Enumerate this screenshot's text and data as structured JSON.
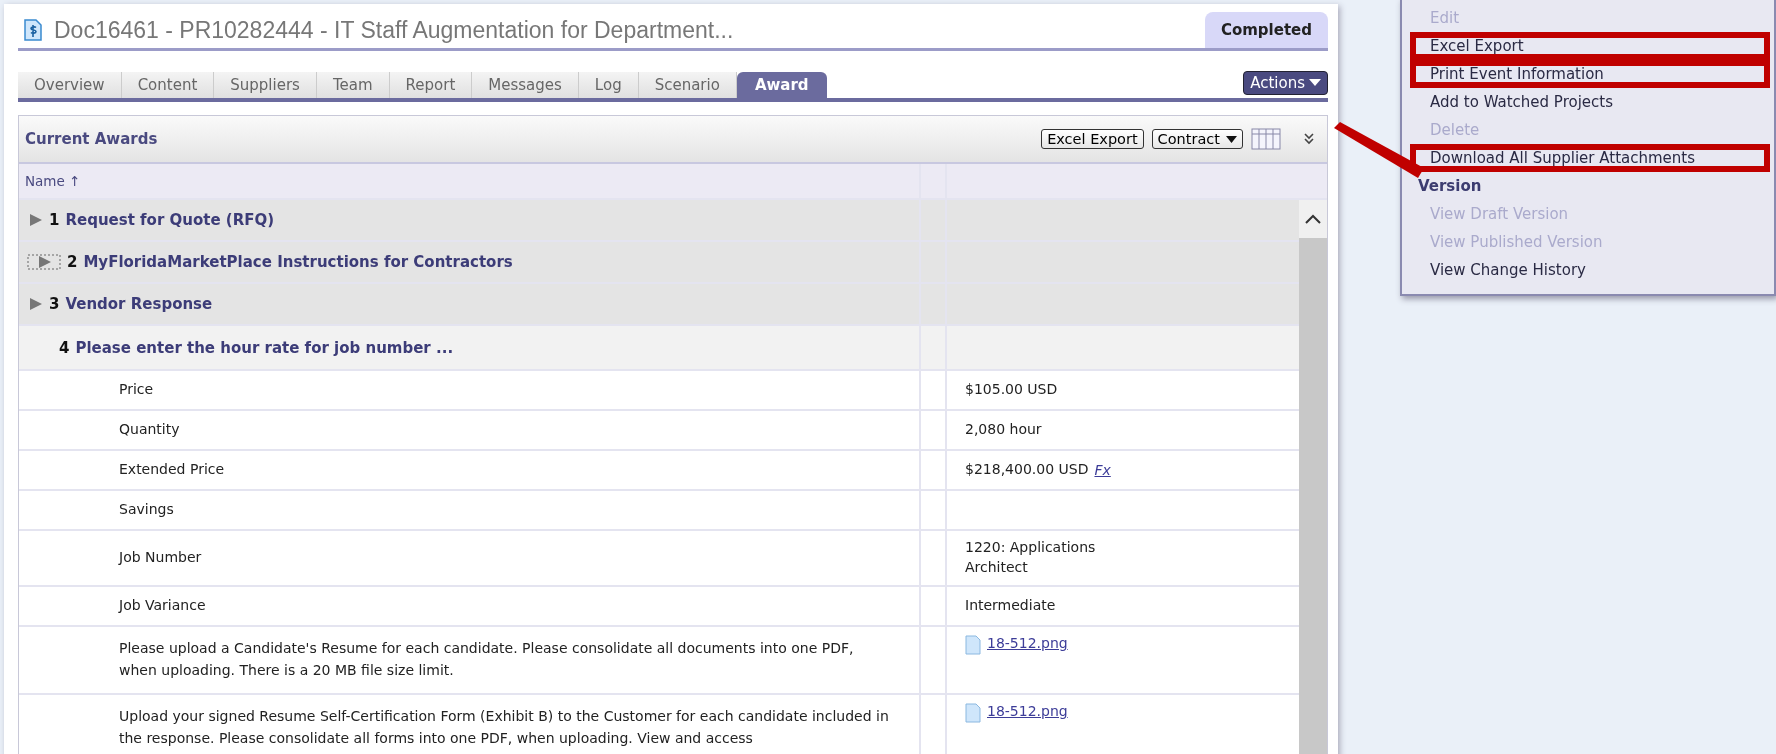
{
  "header": {
    "title": "Doc16461 - PR10282444 - IT Staff Augmentation for Department...",
    "status": "Completed"
  },
  "tabs": [
    {
      "label": "Overview",
      "selected": false
    },
    {
      "label": "Content",
      "selected": false
    },
    {
      "label": "Suppliers",
      "selected": false
    },
    {
      "label": "Team",
      "selected": false
    },
    {
      "label": "Report",
      "selected": false
    },
    {
      "label": "Messages",
      "selected": false
    },
    {
      "label": "Log",
      "selected": false
    },
    {
      "label": "Scenario",
      "selected": false
    },
    {
      "label": "Award",
      "selected": true
    }
  ],
  "actions_button": "Actions",
  "panel": {
    "title": "Current Awards",
    "buttons": [
      {
        "label": "Excel Export",
        "kind": "plain"
      },
      {
        "label": "Contract",
        "kind": "dropdown"
      }
    ]
  },
  "table": {
    "columns": [
      "Name ↑"
    ],
    "rows": [
      {
        "kind": "section",
        "number": "1",
        "title": "Request for Quote (RFQ)",
        "expanded": false,
        "focused": false
      },
      {
        "kind": "section",
        "number": "2",
        "title": "MyFloridaMarketPlace Instructions for Contractors",
        "expanded": false,
        "focused": true
      },
      {
        "kind": "section",
        "number": "3",
        "title": "Vendor Response",
        "expanded": false,
        "focused": false
      },
      {
        "kind": "section",
        "number": "4",
        "title": "Please enter the hour rate for job number ...",
        "expanded": true,
        "focused": false
      },
      {
        "kind": "field",
        "label": "Price",
        "value": "$105.00 USD"
      },
      {
        "kind": "field",
        "label": "Quantity",
        "value": "2,080 hour"
      },
      {
        "kind": "field",
        "label": "Extended Price",
        "value": "$218,400.00 USD",
        "link": "Fx"
      },
      {
        "kind": "field",
        "label": "Savings"
      },
      {
        "kind": "field",
        "label": "Job Number",
        "value": "1220: Applications Architect"
      },
      {
        "kind": "field",
        "label": "Job Variance",
        "value": "Intermediate"
      },
      {
        "kind": "field",
        "label": "Please upload a Candidate's Resume for each candidate. Please consolidate all documents into one PDF, when uploading. There is a 20 MB file size limit.",
        "file": "18-512.png"
      },
      {
        "kind": "field",
        "label": "Upload your signed Resume Self-Certification Form (Exhibit B) to the Customer for each candidate included in the response. Please consolidate all forms into one PDF, when uploading. View and access",
        "file": "18-512.png"
      }
    ]
  },
  "menu": [
    {
      "kind": "item",
      "label": "Edit",
      "disabled": true,
      "highlighted": false
    },
    {
      "kind": "item",
      "label": "Excel Export",
      "disabled": false,
      "highlighted": true
    },
    {
      "kind": "item",
      "label": "Print Event Information",
      "disabled": false,
      "highlighted": true
    },
    {
      "kind": "item",
      "label": "Add to Watched Projects",
      "disabled": false,
      "highlighted": false
    },
    {
      "kind": "item",
      "label": "Delete",
      "disabled": true,
      "highlighted": false
    },
    {
      "kind": "item",
      "label": "Download All Supplier Attachments",
      "disabled": false,
      "highlighted": true
    },
    {
      "kind": "header",
      "label": "Version"
    },
    {
      "kind": "item",
      "label": "View Draft Version",
      "disabled": true,
      "highlighted": false
    },
    {
      "kind": "item",
      "label": "View Published Version",
      "disabled": true,
      "highlighted": false
    },
    {
      "kind": "item",
      "label": "View Change History",
      "disabled": false,
      "highlighted": false
    }
  ]
}
